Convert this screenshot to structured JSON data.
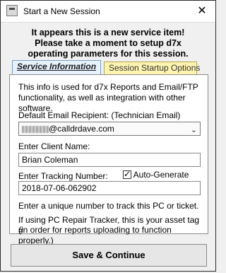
{
  "window": {
    "title": "Start a New Session",
    "close_glyph": "✕"
  },
  "intro": {
    "line1": "It appears this is a new service item!",
    "line2": "Please take a moment to setup d7x",
    "line3": "operating parameters for this session."
  },
  "tabs": [
    {
      "label": "Service Information",
      "active": true
    },
    {
      "label": "Session Startup Options",
      "active": false
    }
  ],
  "panel": {
    "description": "This info is used for d7x Reports and Email/FTP functionality, as well as integration with other software.",
    "email_label": "Default Email Recipient:  (Technician Email)",
    "email_visible_value": "@calldrdave.com",
    "client_label": "Enter Client Name:",
    "client_value": "Brian Coleman",
    "tracking_label": "Enter Tracking Number:",
    "auto_generate_label": "Auto-Generate",
    "auto_generate_checked": true,
    "tracking_value": "2018-07-06-062902",
    "unique_note": "Enter a unique number to track this PC or ticket.",
    "asset_note_1": "If using PC Repair Tracker, this is your asset tag #",
    "asset_note_2": "(in order for reports uploading to function properly.)"
  },
  "buttons": {
    "save_continue": "Save & Continue"
  },
  "icons": {
    "app": "app-icon",
    "dropdown": "chevron-down-icon",
    "close": "close-icon"
  },
  "colors": {
    "active_tab_bg": "#e7f2ff",
    "inactive_tab_bg": "#fff4b0"
  }
}
